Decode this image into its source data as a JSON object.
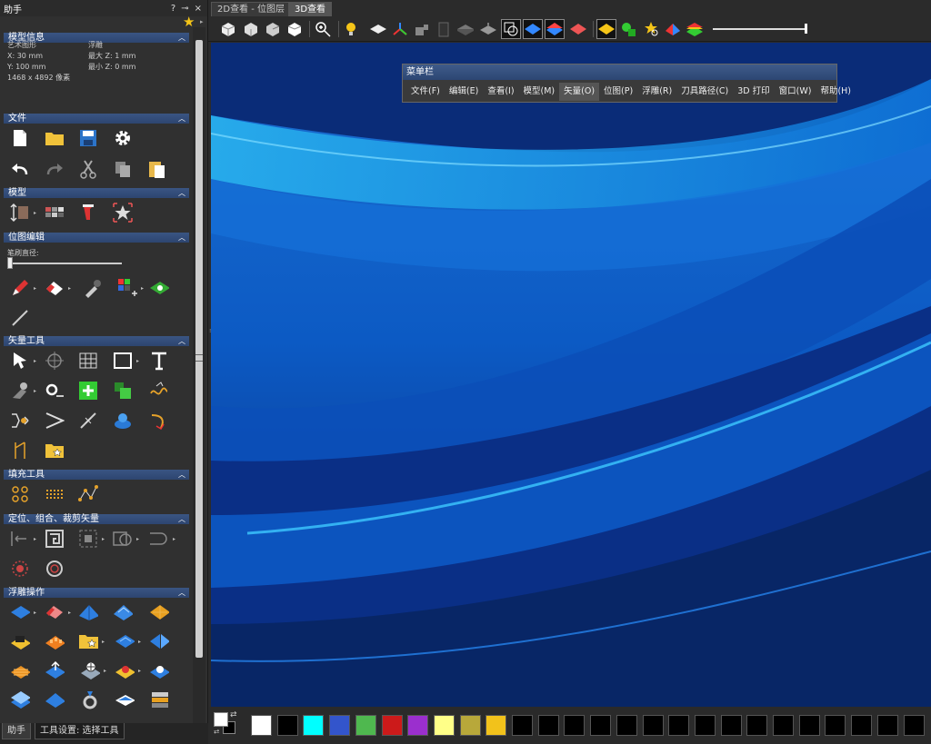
{
  "panel": {
    "title": "助手",
    "controls": [
      "?",
      "ₓ",
      "×"
    ],
    "tabs": {
      "helper": "助手",
      "tool_settings": "工具设置: 选择工具"
    }
  },
  "model_info": {
    "header": "模型信息",
    "art_label": "艺术图形",
    "relief_label": "浮雕",
    "x": "X: 30 mm",
    "y": "Y: 100 mm",
    "max_z": "最大  Z: 1 mm",
    "min_z": "最小  Z: 0 mm",
    "pixels": "1468 x 4892 像素"
  },
  "sections": {
    "file": "文件",
    "model": "模型",
    "bitmap_edit": "位图编辑",
    "vector_tools": "矢量工具",
    "fill_tools": "填充工具",
    "position_group": "定位、组合、裁剪矢量",
    "relief_ops": "浮雕操作"
  },
  "brush_label": "笔刷直径:",
  "doc_tabs": [
    "2D查看 - 位图层",
    "3D查看"
  ],
  "menubar": {
    "title": "菜单栏",
    "items": [
      "文件(F)",
      "编辑(E)",
      "查看(I)",
      "模型(M)",
      "矢量(O)",
      "位图(P)",
      "浮雕(R)",
      "刀具路径(C)",
      "3D 打印",
      "窗口(W)",
      "帮助(H)"
    ]
  },
  "palette": {
    "colors": [
      "#ffffff",
      "#000000",
      "#00ffff",
      "#3355cc",
      "#4fb84f",
      "#cc1a1a",
      "#9b2fce",
      "#ffff88",
      "#b8a83a",
      "#f2c21b",
      "#000000",
      "#000000",
      "#000000",
      "#000000",
      "#000000",
      "#000000",
      "#000000",
      "#000000",
      "#000000",
      "#000000",
      "#000000",
      "#000000",
      "#000000",
      "#000000",
      "#000000",
      "#000000"
    ]
  },
  "icons": {
    "file": [
      "new-file-icon",
      "open-folder-icon",
      "save-icon",
      "settings-gear-icon",
      "undo-icon",
      "redo-icon",
      "cut-icon",
      "copy-icon",
      "paste-icon"
    ],
    "model": [
      "model-size-icon",
      "model-grid-icon",
      "model-pin-icon",
      "model-star-icon"
    ],
    "bitmap": [
      "pencil-icon",
      "eraser-icon",
      "eyedropper-icon",
      "color-pixels-icon",
      "green-layer-icon",
      "line-pen-icon"
    ],
    "vector": [
      "select-arrow-icon",
      "transform-icon",
      "mesh-grid-icon",
      "rectangle-icon",
      "text-icon",
      "node-edit-icon",
      "measure-icon",
      "add-green-icon",
      "vector-layers-icon",
      "wave-icon",
      "mirror-icon",
      "offset-icon",
      "magic-wand-icon",
      "blue-blob-icon",
      "curve-arrow-icon",
      "bookmark-icon",
      "star-folder-icon"
    ],
    "fill": [
      "fill-circles-icon",
      "fill-dots-icon",
      "fill-path-icon"
    ],
    "position": [
      "align-icon",
      "group-icon",
      "crop-icon",
      "weld-icon",
      "trim-icon",
      "snap-target-icon",
      "spiral-icon"
    ],
    "relief": [
      "relief-diamond-icon",
      "relief-eraser-icon",
      "relief-blue-icon",
      "relief-sketch-icon",
      "relief-gold-icon",
      "relief-layer-yellow-icon",
      "relief-orange-icon",
      "relief-star-folder-icon",
      "relief-merge-icon",
      "relief-split-icon",
      "relief-stack-icon",
      "relief-up-icon",
      "relief-drag-icon",
      "relief-target-icon",
      "relief-tool-icon",
      "relief-layers-icon",
      "relief-flat-icon",
      "relief-ring-icon",
      "relief-blob-icon",
      "relief-stack2-icon"
    ]
  }
}
